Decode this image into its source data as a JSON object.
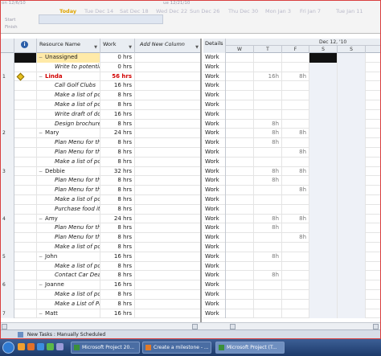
{
  "timeline": {
    "top_dates": [
      "on 12/6/10",
      "ue 12/21/10"
    ],
    "dates": [
      {
        "label": "Today",
        "today": true
      },
      {
        "label": "Tue Dec 14"
      },
      {
        "label": "Sat Dec 18"
      },
      {
        "label": "Wed Dec 22"
      },
      {
        "label": "Sun Dec 26"
      },
      {
        "label": "Thu Dec 30"
      },
      {
        "label": "Mon Jan 3"
      },
      {
        "label": "Fri Jan 7"
      },
      {
        "label": "Tue Jan 11"
      }
    ],
    "start_label": "Start",
    "finish_label": "Finish"
  },
  "grid": {
    "headers": {
      "name": "Resource Name",
      "work": "Work",
      "add": "Add New Column"
    }
  },
  "timephased": {
    "details_header": "Details",
    "week_label": "Dec 12, '10",
    "days": [
      "W",
      "T",
      "F",
      "S",
      "S"
    ]
  },
  "rows": [
    {
      "id": "",
      "name": "Unassigned",
      "work": "0 hrs",
      "kind": "summary",
      "detail": "Work",
      "tp": [
        "",
        "",
        "",
        "",
        ""
      ],
      "black": true
    },
    {
      "id": "",
      "name": "Write to potentia",
      "work": "0 hrs",
      "kind": "task",
      "detail": "Work",
      "tp": [
        "",
        "",
        "",
        "",
        ""
      ]
    },
    {
      "id": "1",
      "name": "Linda",
      "work": "56 hrs",
      "kind": "summary",
      "over": true,
      "warn": true,
      "detail": "Work",
      "tp": [
        "",
        "16h",
        "8h",
        "",
        ""
      ]
    },
    {
      "id": "",
      "name": "Call Golf Clubs",
      "work": "16 hrs",
      "kind": "task",
      "detail": "Work",
      "tp": [
        "",
        "",
        "",
        "",
        ""
      ]
    },
    {
      "id": "",
      "name": "Make a list of po",
      "work": "8 hrs",
      "kind": "task",
      "detail": "Work",
      "tp": [
        "",
        "",
        "",
        "",
        ""
      ]
    },
    {
      "id": "",
      "name": "Make a list of po",
      "work": "8 hrs",
      "kind": "task",
      "detail": "Work",
      "tp": [
        "",
        "",
        "",
        "",
        ""
      ]
    },
    {
      "id": "",
      "name": "Write draft of do",
      "work": "16 hrs",
      "kind": "task",
      "detail": "Work",
      "tp": [
        "",
        "",
        "",
        "",
        ""
      ]
    },
    {
      "id": "",
      "name": "Design brochure",
      "work": "8 hrs",
      "kind": "task",
      "detail": "Work",
      "tp": [
        "",
        "8h",
        "",
        "",
        ""
      ]
    },
    {
      "id": "2",
      "name": "Mary",
      "work": "24 hrs",
      "kind": "summary",
      "detail": "Work",
      "tp": [
        "",
        "8h",
        "8h",
        "",
        ""
      ]
    },
    {
      "id": "",
      "name": "Plan Menu for th",
      "work": "8 hrs",
      "kind": "task",
      "detail": "Work",
      "tp": [
        "",
        "8h",
        "",
        "",
        ""
      ]
    },
    {
      "id": "",
      "name": "Plan Menu for th",
      "work": "8 hrs",
      "kind": "task",
      "detail": "Work",
      "tp": [
        "",
        "",
        "8h",
        "",
        ""
      ]
    },
    {
      "id": "",
      "name": "Make a list of po",
      "work": "8 hrs",
      "kind": "task",
      "detail": "Work",
      "tp": [
        "",
        "",
        "",
        "",
        ""
      ]
    },
    {
      "id": "3",
      "name": "Debbie",
      "work": "32 hrs",
      "kind": "summary",
      "detail": "Work",
      "tp": [
        "",
        "8h",
        "8h",
        "",
        ""
      ]
    },
    {
      "id": "",
      "name": "Plan Menu for th",
      "work": "8 hrs",
      "kind": "task",
      "detail": "Work",
      "tp": [
        "",
        "8h",
        "",
        "",
        ""
      ]
    },
    {
      "id": "",
      "name": "Plan Menu for th",
      "work": "8 hrs",
      "kind": "task",
      "detail": "Work",
      "tp": [
        "",
        "",
        "8h",
        "",
        ""
      ]
    },
    {
      "id": "",
      "name": "Make a list of po",
      "work": "8 hrs",
      "kind": "task",
      "detail": "Work",
      "tp": [
        "",
        "",
        "",
        "",
        ""
      ]
    },
    {
      "id": "",
      "name": "Purchase food it",
      "work": "8 hrs",
      "kind": "task",
      "detail": "Work",
      "tp": [
        "",
        "",
        "",
        "",
        ""
      ]
    },
    {
      "id": "4",
      "name": "Amy",
      "work": "24 hrs",
      "kind": "summary",
      "detail": "Work",
      "tp": [
        "",
        "8h",
        "8h",
        "",
        ""
      ]
    },
    {
      "id": "",
      "name": "Plan Menu for th",
      "work": "8 hrs",
      "kind": "task",
      "detail": "Work",
      "tp": [
        "",
        "8h",
        "",
        "",
        ""
      ]
    },
    {
      "id": "",
      "name": "Plan Menu for th",
      "work": "8 hrs",
      "kind": "task",
      "detail": "Work",
      "tp": [
        "",
        "",
        "8h",
        "",
        ""
      ]
    },
    {
      "id": "",
      "name": "Make a list of po",
      "work": "8 hrs",
      "kind": "task",
      "detail": "Work",
      "tp": [
        "",
        "",
        "",
        "",
        ""
      ]
    },
    {
      "id": "5",
      "name": "John",
      "work": "16 hrs",
      "kind": "summary",
      "detail": "Work",
      "tp": [
        "",
        "8h",
        "",
        "",
        ""
      ]
    },
    {
      "id": "",
      "name": "Make a list of po",
      "work": "8 hrs",
      "kind": "task",
      "detail": "Work",
      "tp": [
        "",
        "",
        "",
        "",
        ""
      ]
    },
    {
      "id": "",
      "name": "Contact Car Dea",
      "work": "8 hrs",
      "kind": "task",
      "detail": "Work",
      "tp": [
        "",
        "8h",
        "",
        "",
        ""
      ]
    },
    {
      "id": "6",
      "name": "Joanne",
      "work": "16 hrs",
      "kind": "summary",
      "detail": "Work",
      "tp": [
        "",
        "",
        "",
        "",
        ""
      ]
    },
    {
      "id": "",
      "name": "Make a list of po",
      "work": "8 hrs",
      "kind": "task",
      "detail": "Work",
      "tp": [
        "",
        "",
        "",
        "",
        ""
      ]
    },
    {
      "id": "",
      "name": "Make a List of Pr",
      "work": "8 hrs",
      "kind": "task",
      "detail": "Work",
      "tp": [
        "",
        "",
        "",
        "",
        ""
      ]
    },
    {
      "id": "7",
      "name": "Matt",
      "work": "16 hrs",
      "kind": "summary",
      "detail": "Work",
      "tp": [
        "",
        "",
        "",
        "",
        ""
      ]
    }
  ],
  "status": {
    "text": "New Tasks : Manually Scheduled"
  },
  "taskbar": {
    "buttons": [
      {
        "label": "Microsoft Project 20..."
      },
      {
        "label": "Create a milestone - ..."
      },
      {
        "label": "Microsoft Project (T..."
      }
    ]
  }
}
